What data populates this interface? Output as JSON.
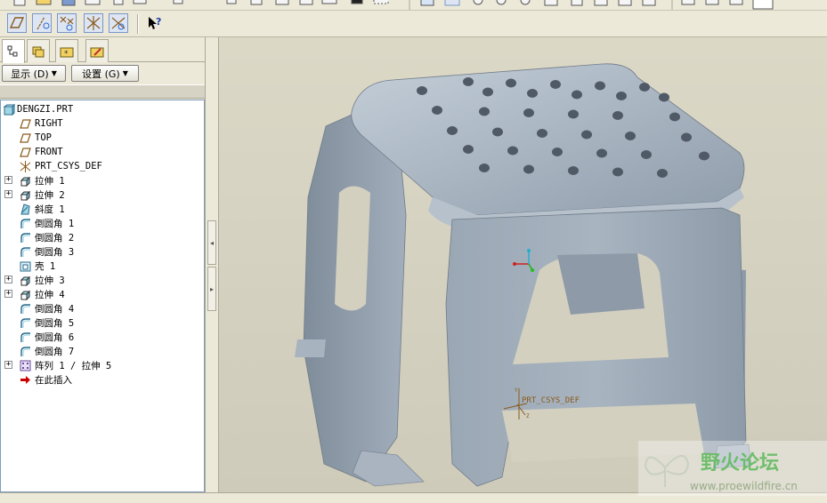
{
  "toolbar": {
    "help_icon": "whats-this-help-icon"
  },
  "left_panel": {
    "tabs": [
      "model-tree-tab",
      "layer-tree-tab",
      "favorites-tab",
      "feature-tab"
    ],
    "display_menu": "显示 (D)",
    "settings_menu": "设置 (G)"
  },
  "tree": {
    "root": "DENGZI.PRT",
    "items": [
      {
        "label": "RIGHT",
        "icon": "datum-plane-icon",
        "expandable": false
      },
      {
        "label": "TOP",
        "icon": "datum-plane-icon",
        "expandable": false
      },
      {
        "label": "FRONT",
        "icon": "datum-plane-icon",
        "expandable": false
      },
      {
        "label": "PRT_CSYS_DEF",
        "icon": "coordinate-system-icon",
        "expandable": false
      },
      {
        "label": "拉伸 1",
        "icon": "extrude-icon",
        "expandable": true
      },
      {
        "label": "拉伸 2",
        "icon": "extrude-icon",
        "expandable": true
      },
      {
        "label": "斜度 1",
        "icon": "draft-icon",
        "expandable": false
      },
      {
        "label": "倒圆角 1",
        "icon": "round-icon",
        "expandable": false
      },
      {
        "label": "倒圆角 2",
        "icon": "round-icon",
        "expandable": false
      },
      {
        "label": "倒圆角 3",
        "icon": "round-icon",
        "expandable": false
      },
      {
        "label": "壳 1",
        "icon": "shell-icon",
        "expandable": false
      },
      {
        "label": "拉伸 3",
        "icon": "extrude-icon",
        "expandable": true
      },
      {
        "label": "拉伸 4",
        "icon": "extrude-icon",
        "expandable": true
      },
      {
        "label": "倒圆角 4",
        "icon": "round-icon",
        "expandable": false
      },
      {
        "label": "倒圆角 5",
        "icon": "round-icon",
        "expandable": false
      },
      {
        "label": "倒圆角 6",
        "icon": "round-icon",
        "expandable": false
      },
      {
        "label": "倒圆角 7",
        "icon": "round-icon",
        "expandable": false
      },
      {
        "label": "阵列 1 / 拉伸 5",
        "icon": "pattern-icon",
        "expandable": true
      },
      {
        "label": "在此插入",
        "icon": "insert-here-arrow-icon",
        "expandable": false
      }
    ]
  },
  "viewport": {
    "csys_label": "PRT_CSYS_DEF",
    "model_color": "#9aa7b4"
  },
  "watermark": {
    "title": "野火论坛",
    "url": "www.proewildfire.cn"
  },
  "colors": {
    "chrome": "#ece9d8",
    "tree_bg": "#ffffff",
    "insert_arrow": "#cc0000",
    "watermark_green": "#4caf50"
  }
}
